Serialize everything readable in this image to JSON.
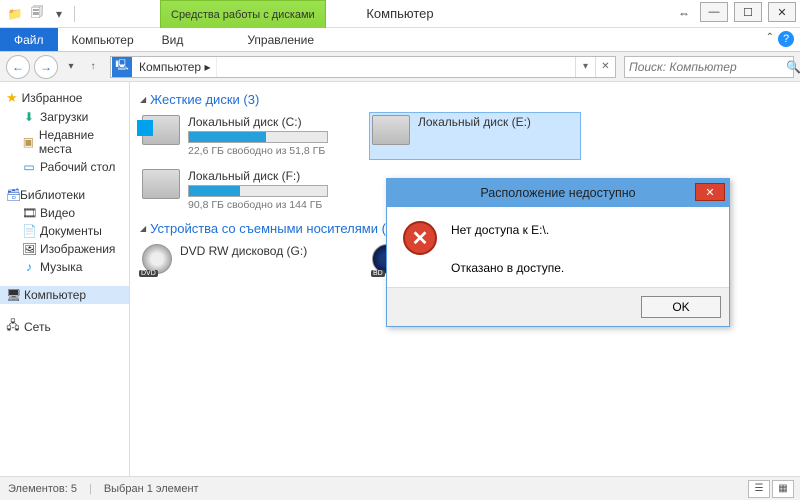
{
  "window": {
    "title": "Компьютер",
    "contextual_tab": "Средства работы с дисками"
  },
  "ribbon": {
    "file": "Файл",
    "computer": "Компьютер",
    "view": "Вид",
    "manage": "Управление"
  },
  "nav": {
    "breadcrumb": "Компьютер",
    "search_placeholder": "Поиск: Компьютер"
  },
  "sidebar": {
    "favorites": "Избранное",
    "favorites_items": {
      "0": "Загрузки",
      "1": "Недавние места",
      "2": "Рабочий стол"
    },
    "libraries": "Библиотеки",
    "libraries_items": {
      "0": "Видео",
      "1": "Документы",
      "2": "Изображения",
      "3": "Музыка"
    },
    "computer": "Компьютер",
    "network": "Сеть"
  },
  "groups": {
    "hdd": {
      "label": "Жесткие диски (3)"
    },
    "removable": {
      "label": "Устройства со съемными носителями (2)"
    }
  },
  "drives": {
    "c": {
      "name": "Локальный диск (C:)",
      "sub": "22,6 ГБ свободно из 51,8 ГБ",
      "fill": "56%"
    },
    "e": {
      "name": "Локальный диск (E:)"
    },
    "f": {
      "name": "Локальный диск (F:)",
      "sub": "90,8 ГБ свободно из 144 ГБ",
      "fill": "37%"
    },
    "g": {
      "name": "DVD RW дисковод (G:)"
    }
  },
  "status": {
    "count": "Элементов: 5",
    "selected": "Выбран 1 элемент"
  },
  "dialog": {
    "title": "Расположение недоступно",
    "line1": "Нет доступа к E:\\.",
    "line2": "Отказано в доступе.",
    "ok": "OK"
  }
}
